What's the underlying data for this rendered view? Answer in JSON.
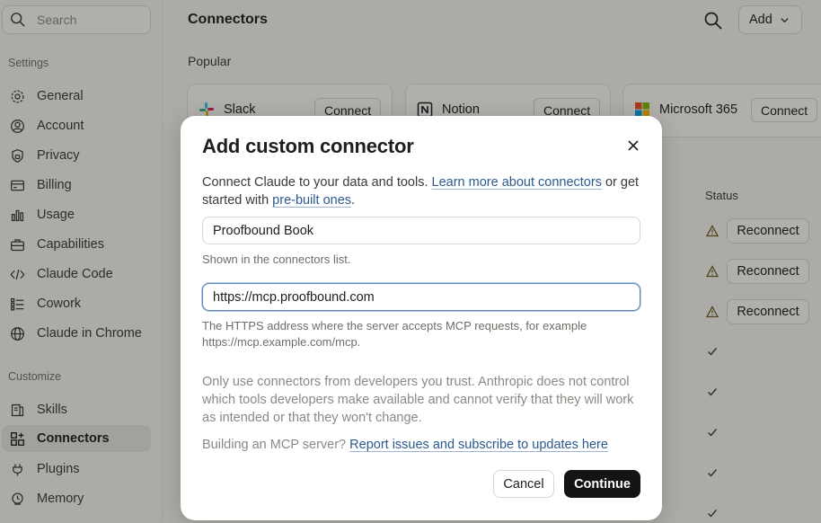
{
  "sidebar": {
    "search_placeholder": "Search",
    "settings_label": "Settings",
    "settings_items": [
      {
        "label": "General",
        "icon": "gear-icon"
      },
      {
        "label": "Account",
        "icon": "user-circle-icon"
      },
      {
        "label": "Privacy",
        "icon": "shield-icon"
      },
      {
        "label": "Billing",
        "icon": "credit-card-icon"
      },
      {
        "label": "Usage",
        "icon": "bar-chart-icon"
      },
      {
        "label": "Capabilities",
        "icon": "toolbox-icon"
      },
      {
        "label": "Claude Code",
        "icon": "code-icon"
      },
      {
        "label": "Cowork",
        "icon": "checklist-icon"
      },
      {
        "label": "Claude in Chrome",
        "icon": "globe-icon"
      }
    ],
    "customize_label": "Customize",
    "customize_items": [
      {
        "label": "Skills",
        "icon": "book-icon"
      },
      {
        "label": "Connectors",
        "icon": "grid-plus-icon",
        "active": true
      },
      {
        "label": "Plugins",
        "icon": "plug-icon"
      },
      {
        "label": "Memory",
        "icon": "memory-icon"
      }
    ]
  },
  "header": {
    "title": "Connectors",
    "add_label": "Add"
  },
  "popular": {
    "label": "Popular",
    "cards": [
      {
        "name": "Slack",
        "button": "Connect",
        "icon": "slack-logo"
      },
      {
        "name": "Notion",
        "button": "Connect",
        "icon": "notion-logo"
      },
      {
        "name": "Microsoft 365",
        "button": "Connect",
        "icon": "microsoft-logo"
      }
    ]
  },
  "table": {
    "status_header": "Status",
    "reconnect_label": "Reconnect"
  },
  "modal": {
    "title": "Add custom connector",
    "intro_text_1": "Connect Claude to your data and tools. ",
    "intro_link_1": "Learn more about connectors",
    "intro_text_2": " or get started with ",
    "intro_link_2": "pre-built ones",
    "intro_text_3": ".",
    "name_value": "Proofbound Book",
    "name_hint": "Shown in the connectors list.",
    "url_value": "https://mcp.proofbound.com",
    "url_hint": "The HTTPS address where the server accepts MCP requests, for example https://mcp.example.com/mcp.",
    "trust_text": "Only use connectors from developers you trust. Anthropic does not control which tools developers make available and cannot verify that they will work as intended or that they won't change.",
    "build_text": "Building an MCP server? ",
    "build_link": "Report issues and subscribe to updates here",
    "cancel_label": "Cancel",
    "continue_label": "Continue"
  },
  "colors": {
    "accent_link": "#2c5a8f",
    "primary_button": "#141413",
    "warning": "#8a6d1a"
  }
}
